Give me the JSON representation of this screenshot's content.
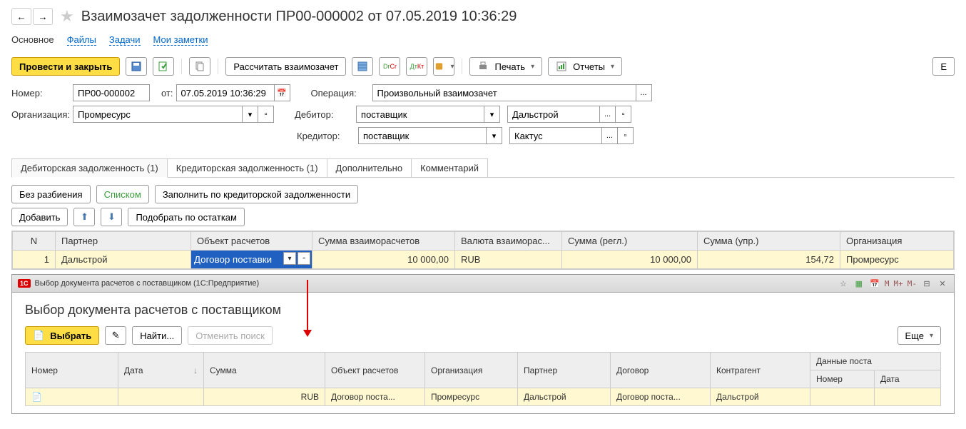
{
  "header": {
    "title": "Взаимозачет задолженности ПР00-000002 от 07.05.2019 10:36:29"
  },
  "links": {
    "main": "Основное",
    "files": "Файлы",
    "tasks": "Задачи",
    "notes": "Мои заметки"
  },
  "toolbar": {
    "post_close": "Провести и закрыть",
    "calc": "Рассчитать взаимозачет",
    "print": "Печать",
    "reports": "Отчеты",
    "more": "Е"
  },
  "form": {
    "number_label": "Номер:",
    "number_value": "ПР00-000002",
    "from_label": "от:",
    "date_value": "07.05.2019 10:36:29",
    "operation_label": "Операция:",
    "operation_value": "Произвольный взаимозачет",
    "org_label": "Организация:",
    "org_value": "Промресурс",
    "debtor_label": "Дебитор:",
    "debtor_type": "поставщик",
    "debtor_value": "Дальстрой",
    "creditor_label": "Кредитор:",
    "creditor_type": "поставщик",
    "creditor_value": "Кактус"
  },
  "tabs": {
    "t1": "Дебиторская задолженность (1)",
    "t2": "Кредиторская задолженность (1)",
    "t3": "Дополнительно",
    "t4": "Комментарий"
  },
  "subtb": {
    "no_split": "Без разбиения",
    "list": "Списком",
    "fill": "Заполнить по кредиторской задолженности",
    "add": "Добавить",
    "pick": "Подобрать по остаткам"
  },
  "table": {
    "cols": {
      "n": "N",
      "partner": "Партнер",
      "object": "Объект расчетов",
      "sum_settle": "Сумма взаиморасчетов",
      "currency": "Валюта взаиморас...",
      "sum_regl": "Сумма (регл.)",
      "sum_upr": "Сумма (упр.)",
      "org": "Организация"
    },
    "row": {
      "n": "1",
      "partner": "Дальстрой",
      "object": "Договор поставки",
      "sum_settle": "10 000,00",
      "currency": "RUB",
      "sum_regl": "10 000,00",
      "sum_upr": "154,72",
      "org": "Промресурс"
    }
  },
  "dialog": {
    "titlebar": "Выбор документа расчетов с поставщиком  (1С:Предприятие)",
    "title": "Выбор документа расчетов с поставщиком",
    "select": "Выбрать",
    "find": "Найти...",
    "cancel_find": "Отменить поиск",
    "more": "Еще",
    "cols": {
      "num": "Номер",
      "date": "Дата",
      "sum": "Сумма",
      "obj": "Объект расчетов",
      "org": "Организация",
      "partner": "Партнер",
      "contract": "Договор",
      "counterparty": "Контрагент",
      "data": "Данные поста",
      "sub_num": "Номер",
      "sub_date": "Дата"
    },
    "row": {
      "sum": "RUB",
      "obj": "Договор поста...",
      "org": "Промресурс",
      "partner": "Дальстрой",
      "contract": "Договор поста...",
      "counterparty": "Дальстрой"
    }
  }
}
